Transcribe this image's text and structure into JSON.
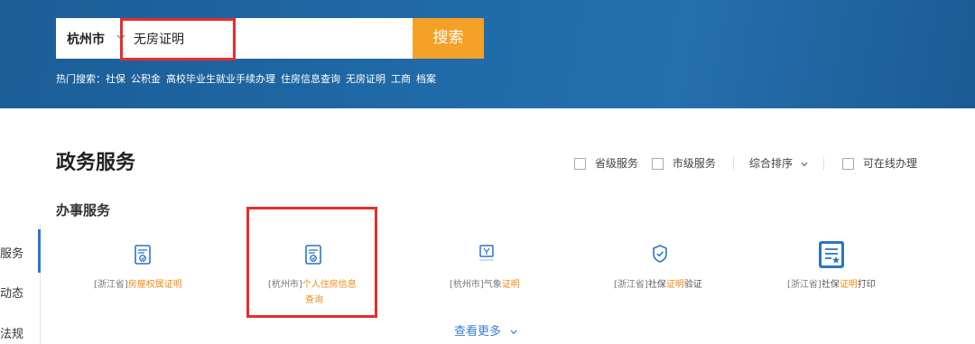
{
  "search": {
    "city": "杭州市",
    "query": "无房证明",
    "button": "搜索",
    "hot_label": "热门搜索：",
    "hot_items": [
      "社保",
      "公积金",
      "高校毕业生就业手续办理",
      "住房信息查询",
      "无房证明",
      "工商",
      "档案"
    ]
  },
  "section": {
    "title": "政务服务",
    "subtitle": "办事服务",
    "filters": {
      "province": "省级服务",
      "city": "市级服务",
      "sort": "综合排序",
      "online": "可在线办理"
    }
  },
  "left_nav": [
    "服务",
    "动态",
    "法规"
  ],
  "services": [
    {
      "prefix": "[浙江省]",
      "name_plain_before": "",
      "name_highlight": "房屋权属证明",
      "name_plain_after": "",
      "icon": "document-badge-icon"
    },
    {
      "prefix": "[杭州市]",
      "name_plain_before": "",
      "name_highlight": "个人住房信息",
      "name_plain_after": "",
      "line2": "查询",
      "icon": "document-badge-icon"
    },
    {
      "prefix": "[杭州市]",
      "name_plain_before": "气象",
      "name_highlight": "证明",
      "name_plain_after": "",
      "icon": "weather-certificate-icon"
    },
    {
      "prefix": "[浙江省]",
      "name_plain_before": "社保",
      "name_highlight": "证明",
      "name_plain_after": "验证",
      "icon": "shield-check-icon"
    },
    {
      "prefix": "[浙江省]",
      "name_plain_before": "社保",
      "name_highlight": "证明",
      "name_plain_after": "打印",
      "icon": "print-document-icon"
    }
  ],
  "more": "查看更多",
  "colors": {
    "banner": "#1f6aa8",
    "accent": "#f5a127",
    "highlight": "#e52d2d",
    "link": "#3a7fd0"
  }
}
